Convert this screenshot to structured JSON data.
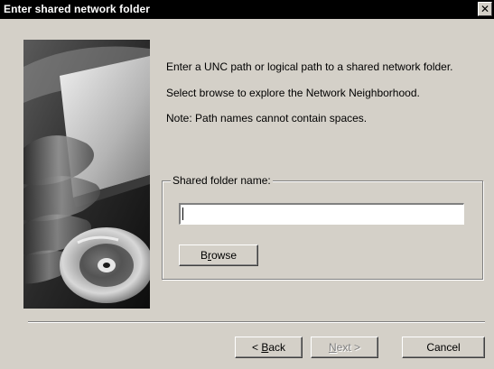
{
  "window": {
    "title": "Enter shared network folder",
    "close_glyph": "✕"
  },
  "info": {
    "line1": "Enter a UNC path or logical path to a shared network folder.",
    "line2": "Select browse to explore the Network Neighborhood.",
    "line3": "Note: Path names cannot contain spaces."
  },
  "group": {
    "legend": "Shared folder name:",
    "field_value": "",
    "browse_pre": "B",
    "browse_accel": "r",
    "browse_post": "owse"
  },
  "buttons": {
    "back_pre": "< ",
    "back_accel": "B",
    "back_post": "ack",
    "next_accel": "N",
    "next_post": "ext >",
    "next_disabled": true,
    "cancel_label": "Cancel"
  },
  "icons": {
    "art": "wizard-hand-cd-image",
    "close": "close-icon"
  }
}
